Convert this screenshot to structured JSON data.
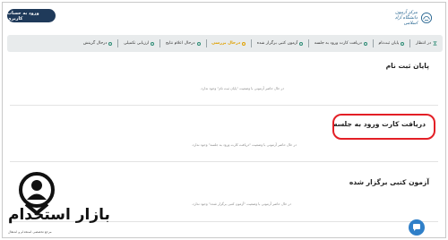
{
  "header": {
    "login_button": "ورود به حساب کاربری",
    "logo_text_line1": "مرکز آزمون",
    "logo_text_line2": "دانشگاه آزاد اسلامی"
  },
  "nav": {
    "items": [
      {
        "label": "در انتظار",
        "active": false
      },
      {
        "label": "پایان ثبت‌نام",
        "active": false
      },
      {
        "label": "دریافت کارت ورود به جلسه",
        "active": false
      },
      {
        "label": "آزمون کتبی برگزار شده",
        "active": false
      },
      {
        "label": "درحال بررسی",
        "active": true
      },
      {
        "label": "درحال اعلام نتایج",
        "active": false
      },
      {
        "label": "ارزیابی تکمیلی",
        "active": false
      },
      {
        "label": "درحال گزینش",
        "active": false
      }
    ]
  },
  "sections": [
    {
      "title": "پایان ثبت نام",
      "note": "در حال حاضر آزمونی با وضعیت \"پایان ثبت نام\" وجود ندارد."
    },
    {
      "title": "دریافت کارت ورود به جلسه",
      "note": "در حال حاضر آزمونی با وضعیت \"دریافت کارت ورود به جلسه\" وجود ندارد."
    },
    {
      "title": "آزمون کتبی برگزار شده",
      "note": "در حال حاضر آزمونی با وضعیت \"آزمون کتبی برگزار شده\" وجود ندارد."
    }
  ],
  "watermark": {
    "text": "بازار استخدام",
    "subtext": "مرجع تخصصی استخدام و اشتغال"
  },
  "colors": {
    "nav_bg": "#e8ebec",
    "active": "#e0a100",
    "highlight": "#e31f26",
    "login_bg": "#1f3a5a",
    "chat": "#2f7fc8"
  }
}
